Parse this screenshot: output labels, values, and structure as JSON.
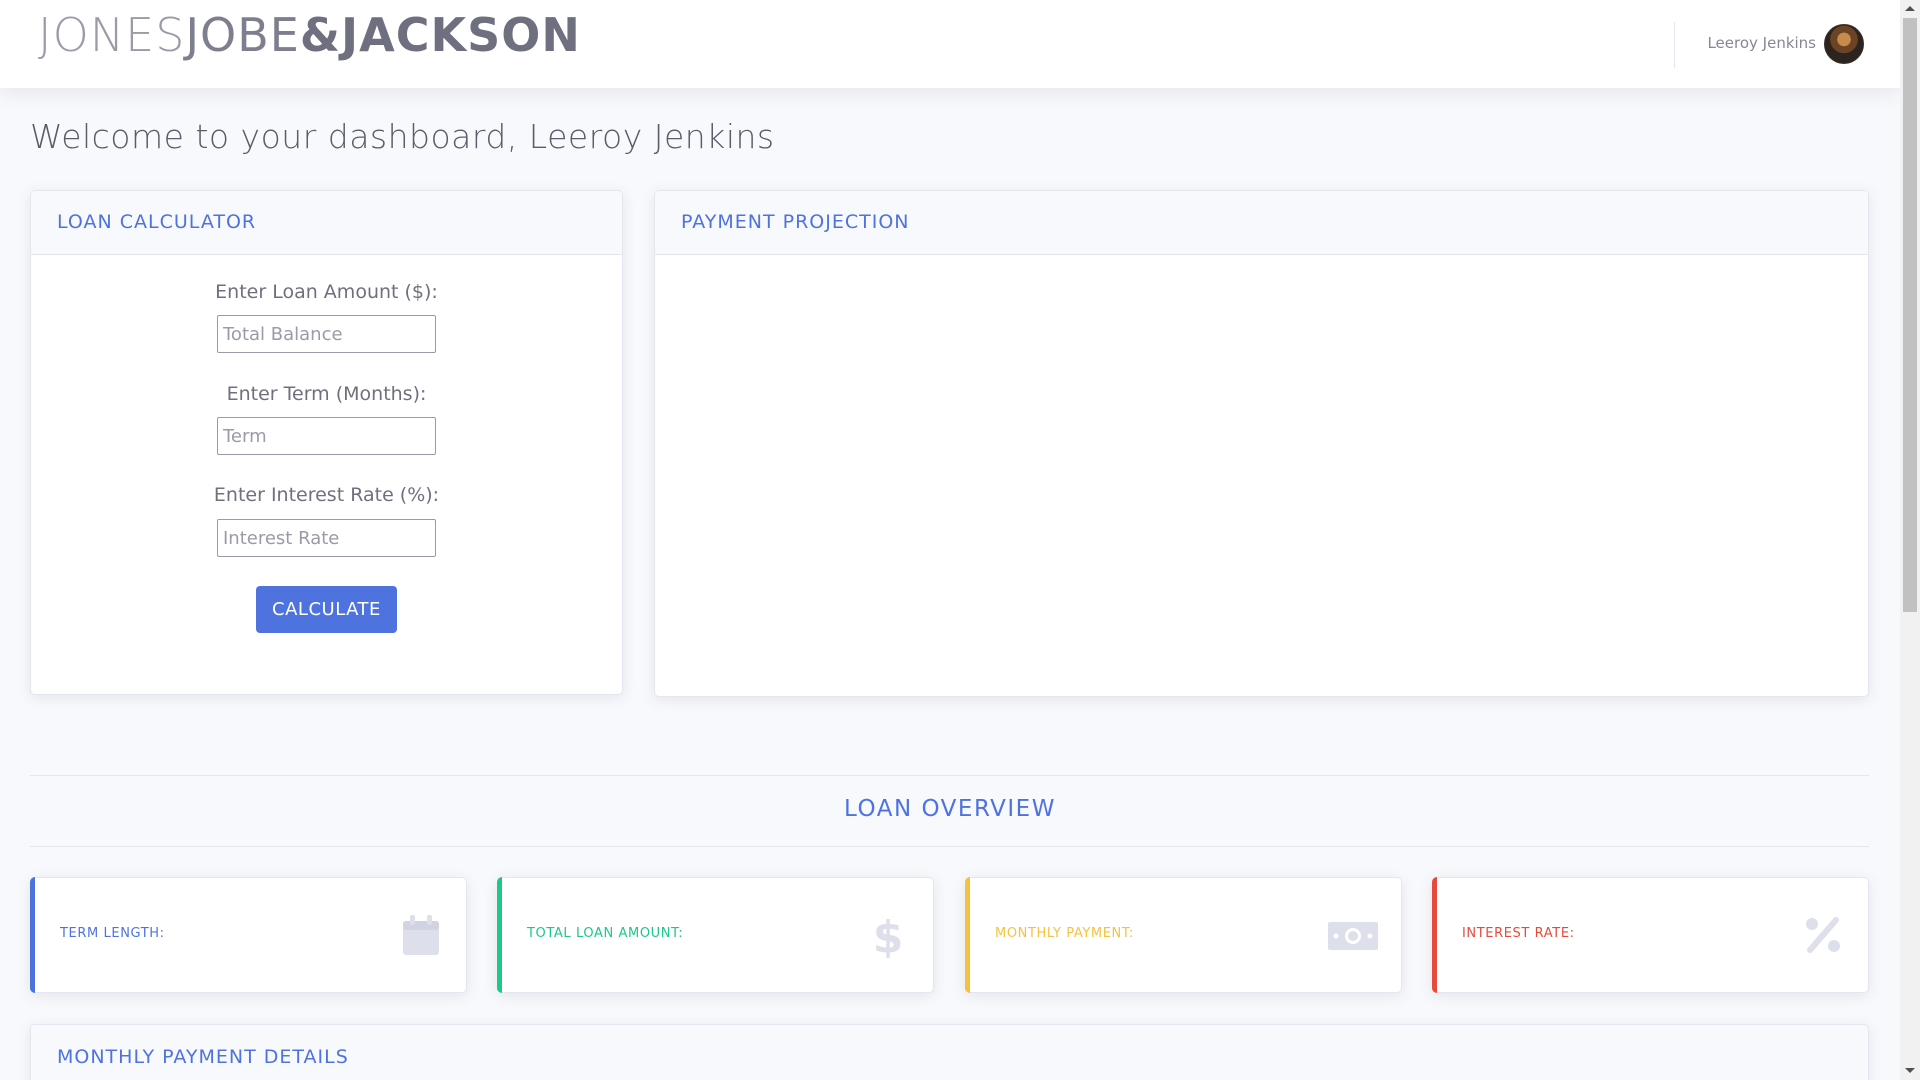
{
  "header": {
    "brand_part1": "JONES",
    "brand_part2": "JOBE",
    "brand_part3": "&JACKSON",
    "user_name": "Leeroy Jenkins"
  },
  "welcome": "Welcome to your dashboard, Leeroy Jenkins",
  "calculator": {
    "title": "LOAN CALCULATOR",
    "loan_label": "Enter Loan Amount ($):",
    "loan_placeholder": "Total Balance",
    "term_label": "Enter Term (Months):",
    "term_placeholder": "Term",
    "rate_label": "Enter Interest Rate (%):",
    "rate_placeholder": "Interest Rate",
    "button_label": "CALCULATE"
  },
  "projection": {
    "title": "PAYMENT PROJECTION"
  },
  "overview": {
    "title": "LOAN OVERVIEW",
    "cards": [
      {
        "label": "TERM LENGTH:",
        "color": "#4e73df",
        "icon": "calendar-icon"
      },
      {
        "label": "TOTAL LOAN AMOUNT:",
        "color": "#1cc88a",
        "icon": "dollar-icon"
      },
      {
        "label": "MONTHLY PAYMENT:",
        "color": "#f6c23e",
        "icon": "money-bill-icon"
      },
      {
        "label": "INTEREST RATE:",
        "color": "#e74a3b",
        "icon": "percent-icon"
      }
    ]
  },
  "details": {
    "title": "MONTHLY PAYMENT DETAILS"
  }
}
